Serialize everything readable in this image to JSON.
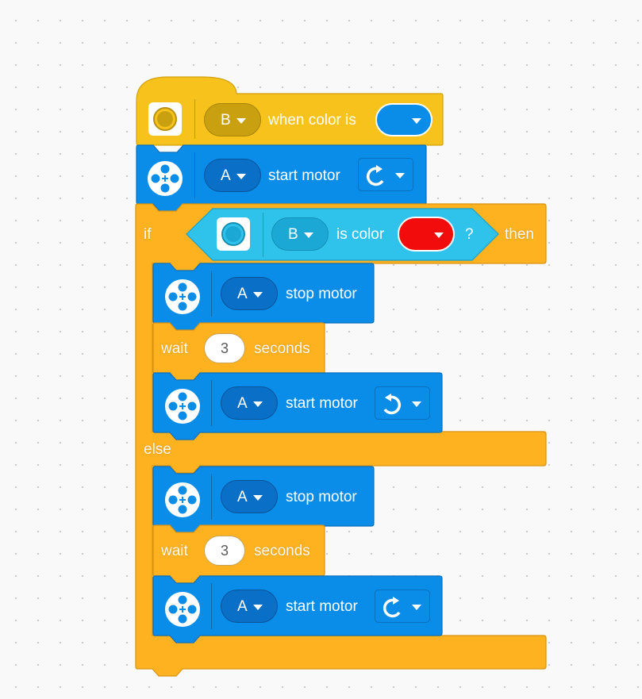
{
  "hat_block": {
    "port": "B",
    "label": "when color is",
    "color_value": "#0a8de8"
  },
  "start_motor_1": {
    "port": "A",
    "label": "start motor",
    "direction": "clockwise"
  },
  "if_block": {
    "if_label": "if",
    "then_label": "then",
    "else_label": "else",
    "condition": {
      "port": "B",
      "label": "is color",
      "color_value": "#f20c0c",
      "question": "?"
    }
  },
  "then_branch": {
    "stop_motor": {
      "port": "A",
      "label": "stop motor"
    },
    "wait": {
      "label": "wait",
      "value": "3",
      "unit": "seconds"
    },
    "start_motor": {
      "port": "A",
      "label": "start motor",
      "direction": "counterclockwise"
    }
  },
  "else_branch": {
    "stop_motor": {
      "port": "A",
      "label": "stop motor"
    },
    "wait": {
      "label": "wait",
      "value": "3",
      "unit": "seconds"
    },
    "start_motor": {
      "port": "A",
      "label": "start motor",
      "direction": "clockwise"
    }
  },
  "colors": {
    "events_yellow": "#f7c21b",
    "motor_blue": "#0a8de8",
    "control_orange": "#ffb21f",
    "sensor_cyan": "#2fc3ec"
  },
  "icons": {
    "color_sensor": "color-sensor-icon",
    "motor": "motor-icon",
    "clockwise": "rotate-clockwise-icon",
    "counterclockwise": "rotate-counterclockwise-icon",
    "dropdown": "chevron-down-icon"
  }
}
